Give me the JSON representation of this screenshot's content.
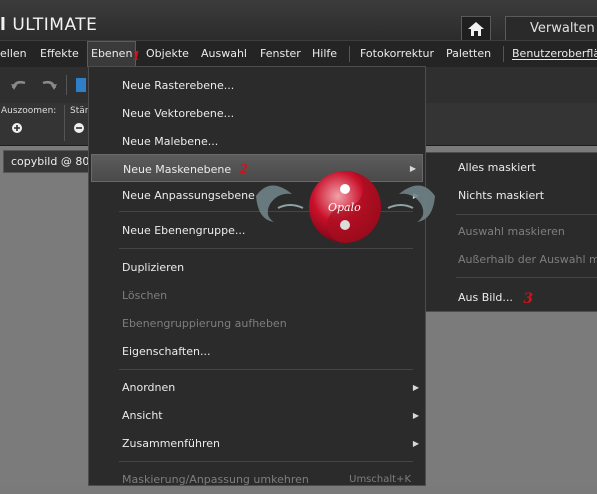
{
  "app": {
    "title": "ULTIMATE",
    "manage_tab": "Verwalten"
  },
  "menubar": {
    "items": [
      {
        "label": "ellen"
      },
      {
        "label": "Effekte"
      },
      {
        "label": "Ebenen"
      },
      {
        "label": "Objekte"
      },
      {
        "label": "Auswahl"
      },
      {
        "label": "Fenster"
      },
      {
        "label": "Hilfe"
      },
      {
        "label": "Fotokorrektur"
      },
      {
        "label": "Paletten"
      },
      {
        "label": "Benutzeroberfläc"
      }
    ],
    "step1": "1"
  },
  "toolbar": {
    "zoom_out_label": "Auszoomen:",
    "strength_label": "Stär"
  },
  "document": {
    "tab_label": "copybild @  80"
  },
  "dropdown": {
    "items": [
      {
        "label": "Neue Rasterebene..."
      },
      {
        "label": "Neue Vektorebene..."
      },
      {
        "label": "Neue Malebene..."
      },
      {
        "label": "Neue Maskenebene",
        "submenu": true,
        "step": "2"
      },
      {
        "label": "Neue Anpassungsebene",
        "submenu": true
      },
      {
        "label": "Neue Ebenengruppe..."
      },
      {
        "label": "Duplizieren"
      },
      {
        "label": "Löschen",
        "disabled": true
      },
      {
        "label": "Ebenengruppierung aufheben",
        "disabled": true
      },
      {
        "label": "Eigenschaften..."
      },
      {
        "label": "Anordnen",
        "submenu": true
      },
      {
        "label": "Ansicht",
        "submenu": true
      },
      {
        "label": "Zusammenführen",
        "submenu": true
      },
      {
        "label": "Maskierung/Anpassung umkehren",
        "disabled": true,
        "shortcut": "Umschalt+K"
      }
    ]
  },
  "submenu": {
    "items": [
      {
        "label": "Alles maskiert"
      },
      {
        "label": "Nichts maskiert"
      },
      {
        "label": "Auswahl maskieren",
        "disabled": true
      },
      {
        "label": "Außerhalb der Auswahl ma",
        "disabled": true
      },
      {
        "label": "Aus Bild...",
        "step": "3"
      }
    ]
  },
  "logo": {
    "text": "Opalo"
  },
  "colors": {
    "accent_red": "#d4101b",
    "menu_bg": "#2b2b2b",
    "highlight_bg": "#555555"
  }
}
